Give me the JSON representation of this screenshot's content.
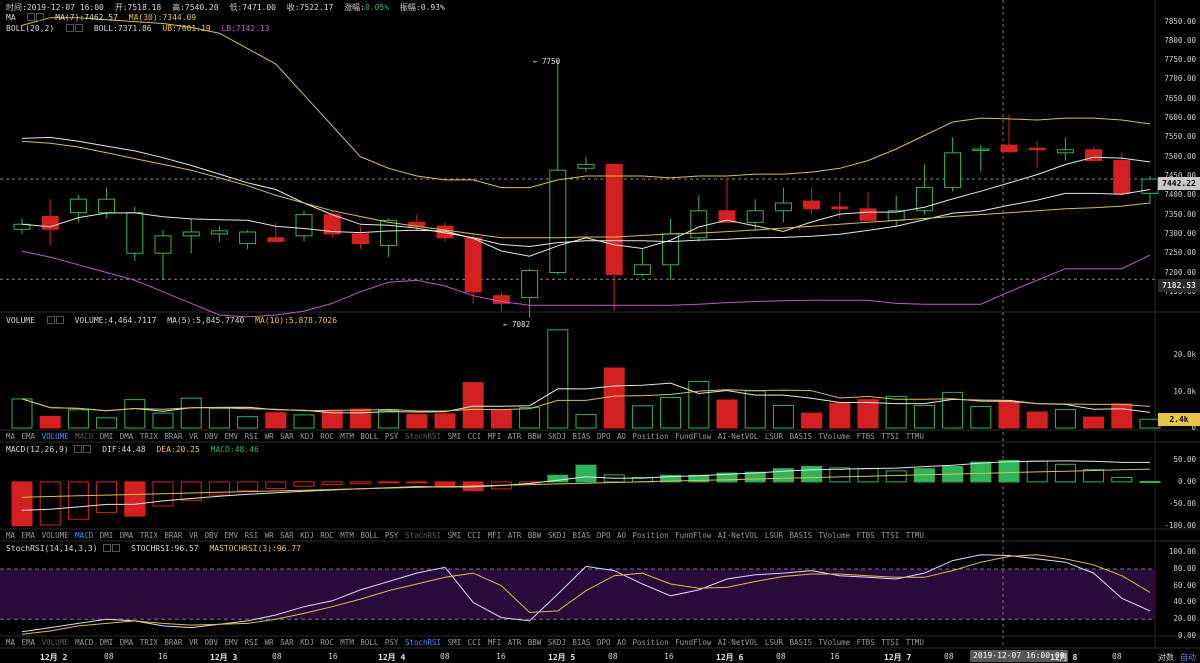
{
  "header": {
    "time": "时间:2019-12-07 16:00",
    "open": "开:7518.18",
    "high": "高:7540.20",
    "low": "低:7471.00",
    "close": "收:7522.17",
    "change_label": "涨幅:",
    "change_value": "0.05%",
    "amplitude": "振幅:0.93%"
  },
  "main_legend": {
    "ma_title": "MA",
    "ma7": "MA(7):7462.57",
    "ma30": "MA(30):7344.09",
    "boll_title": "BOLL(20,2)",
    "boll": "BOLL:7371.86",
    "ub": "UB:7601.19",
    "lb": "LB:7142.13"
  },
  "volume_legend": {
    "title": "VOLUME",
    "volume": "VOLUME:4,464.7117",
    "ma5": "MA(5):5,845.7740",
    "ma10": "MA(10):5,878.7026"
  },
  "macd_legend": {
    "title": "MACD(12,26,9)",
    "dif": "DIF:44.48",
    "dea": "DEA:20.25",
    "macd": "MACD:48.46"
  },
  "stoch_legend": {
    "title": "StochRSI(14,14,3,3)",
    "stochrsi": "STOCHRSI:96.57",
    "mastoch": "MASTOCHRSI(3):96.77"
  },
  "indicator_tabs": [
    "MA",
    "EMA",
    "VOLUME",
    "MACD",
    "DMI",
    "DMA",
    "TRIX",
    "BRAR",
    "VR",
    "OBV",
    "EMV",
    "RSI",
    "WR",
    "SAR",
    "KDJ",
    "ROC",
    "MTM",
    "BOLL",
    "PSY",
    "StochRSI",
    "SMI",
    "CCI",
    "MFI",
    "ATR",
    "BBW",
    "SKDJ",
    "BIAS",
    "DPO",
    "AO",
    "Position",
    "FundFlow",
    "AI-NetVOL",
    "LSUR",
    "BASIS",
    "TVolume",
    "FTBS",
    "TTSI",
    "TTMU"
  ],
  "axes": {
    "price_ticks": [
      "7850.00",
      "7800.00",
      "7750.00",
      "7700.00",
      "7650.00",
      "7600.00",
      "7550.00",
      "7500.00",
      "7450.00",
      "7400.00",
      "7350.00",
      "7300.00",
      "7250.00",
      "7200.00",
      "7150.00",
      "7100.00",
      "7050.00"
    ],
    "current_price": "7442.22",
    "ref_price": "7182.53",
    "high_marker": "← 7750",
    "low_marker": "← 7082",
    "volume_ticks": [
      "20.0k",
      "10.0k",
      "0"
    ],
    "volume_current": "2.4k",
    "macd_ticks": [
      "50.00",
      "0.00",
      "-50.00",
      "-100.00"
    ],
    "stoch_ticks": [
      "100.00",
      "80.00",
      "60.00",
      "40.00",
      "20.00",
      "0.00"
    ],
    "x_labels": [
      {
        "t": "12月 2",
        "day": true
      },
      {
        "t": "08"
      },
      {
        "t": "16"
      },
      {
        "t": "12月 3",
        "day": true
      },
      {
        "t": "08"
      },
      {
        "t": "16"
      },
      {
        "t": "12月 4",
        "day": true
      },
      {
        "t": "08"
      },
      {
        "t": "16"
      },
      {
        "t": "12月 5",
        "day": true
      },
      {
        "t": "08"
      },
      {
        "t": "16"
      },
      {
        "t": "12月 6",
        "day": true
      },
      {
        "t": "08"
      },
      {
        "t": "16"
      },
      {
        "t": "12月 7",
        "day": true
      },
      {
        "t": "08"
      },
      {
        "t": "2019-12-07 16:00:00",
        "cursor": true
      },
      {
        "t": "12月 8",
        "day": true
      },
      {
        "t": "08"
      }
    ],
    "scale_buttons": [
      "对数",
      "自动"
    ]
  },
  "colors": {
    "up": "#2fb45a",
    "down": "#d42020",
    "ma_white": "#e6e6e6",
    "ma_yellow": "#d8c24a",
    "boll_violet": "#c05ac8",
    "highlight_label": "#e9c24a",
    "tab_active": "#4f8fff"
  },
  "chart_data": {
    "type": "candlestick",
    "ohlc": [
      [
        7312,
        7340,
        7300,
        7325
      ],
      [
        7345,
        7390,
        7270,
        7312
      ],
      [
        7355,
        7400,
        7330,
        7390
      ],
      [
        7355,
        7420,
        7340,
        7390
      ],
      [
        7250,
        7370,
        7230,
        7355
      ],
      [
        7250,
        7310,
        7180,
        7295
      ],
      [
        7295,
        7340,
        7250,
        7305
      ],
      [
        7300,
        7320,
        7280,
        7308
      ],
      [
        7275,
        7310,
        7260,
        7305
      ],
      [
        7290,
        7330,
        7280,
        7280
      ],
      [
        7295,
        7360,
        7280,
        7350
      ],
      [
        7350,
        7360,
        7290,
        7300
      ],
      [
        7300,
        7320,
        7260,
        7275
      ],
      [
        7270,
        7340,
        7240,
        7335
      ],
      [
        7330,
        7350,
        7310,
        7320
      ],
      [
        7320,
        7330,
        7280,
        7290
      ],
      [
        7290,
        7300,
        7120,
        7150
      ],
      [
        7140,
        7150,
        7100,
        7120
      ],
      [
        7135,
        7210,
        7082,
        7205
      ],
      [
        7200,
        7750,
        7195,
        7465
      ],
      [
        7470,
        7500,
        7460,
        7480
      ],
      [
        7480,
        7480,
        7100,
        7195
      ],
      [
        7195,
        7260,
        7190,
        7220
      ],
      [
        7220,
        7340,
        7180,
        7300
      ],
      [
        7290,
        7400,
        7280,
        7360
      ],
      [
        7360,
        7440,
        7340,
        7330
      ],
      [
        7330,
        7390,
        7310,
        7360
      ],
      [
        7360,
        7420,
        7330,
        7380
      ],
      [
        7385,
        7420,
        7350,
        7365
      ],
      [
        7370,
        7410,
        7340,
        7365
      ],
      [
        7365,
        7410,
        7340,
        7335
      ],
      [
        7335,
        7400,
        7320,
        7360
      ],
      [
        7360,
        7480,
        7350,
        7420
      ],
      [
        7420,
        7550,
        7410,
        7510
      ],
      [
        7520,
        7530,
        7460,
        7520
      ],
      [
        7530,
        7610,
        7510,
        7513
      ],
      [
        7522,
        7540,
        7471,
        7518
      ],
      [
        7510,
        7550,
        7490,
        7518
      ],
      [
        7518,
        7525,
        7500,
        7490
      ],
      [
        7490,
        7510,
        7400,
        7405
      ],
      [
        7405,
        7450,
        7380,
        7442
      ]
    ],
    "volume": [
      8000,
      3200,
      5000,
      2800,
      7800,
      4100,
      8200,
      5400,
      3100,
      4200,
      3600,
      4700,
      5200,
      4800,
      3700,
      3900,
      12500,
      4900,
      5600,
      27000,
      3700,
      16500,
      6100,
      8400,
      12800,
      7700,
      10200,
      6200,
      4100,
      6800,
      7800,
      8700,
      6200,
      9800,
      5900,
      7300,
      4400,
      5100,
      3000,
      6600,
      2400
    ],
    "macd_hist": [
      -100,
      -98,
      -85,
      -70,
      -78,
      -55,
      -42,
      -30,
      -20,
      -15,
      -10,
      -6,
      -4,
      -2,
      -1,
      -12,
      -20,
      -16,
      -5,
      15,
      38,
      16,
      10,
      15,
      15,
      20,
      22,
      30,
      35,
      32,
      30,
      25,
      30,
      35,
      45,
      49,
      47,
      40,
      28,
      10,
      1
    ],
    "stochrsi_k": [
      5,
      10,
      15,
      20,
      18,
      12,
      10,
      14,
      18,
      25,
      35,
      42,
      55,
      65,
      75,
      82,
      40,
      22,
      18,
      50,
      83,
      78,
      62,
      48,
      55,
      68,
      73,
      75,
      78,
      72,
      70,
      68,
      75,
      90,
      97,
      96,
      92,
      88,
      75,
      45,
      30
    ],
    "stochrsi_d": [
      2,
      6,
      12,
      15,
      18,
      15,
      13,
      14,
      15,
      20,
      27,
      35,
      44,
      54,
      62,
      70,
      75,
      60,
      28,
      30,
      54,
      72,
      75,
      62,
      57,
      58,
      65,
      71,
      74,
      74,
      72,
      70,
      70,
      78,
      88,
      95,
      97,
      92,
      85,
      72,
      52
    ],
    "price_range": [
      7020,
      7880
    ],
    "volume_range": [
      0,
      27500
    ],
    "macd_range": [
      -105,
      68
    ],
    "stoch_range": [
      0,
      105
    ]
  }
}
